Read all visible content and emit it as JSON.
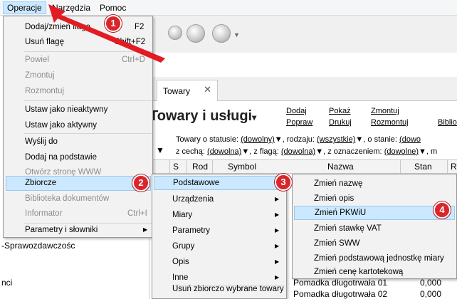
{
  "menubar": {
    "items": [
      "Operacje",
      "Narzędzia",
      "Pomoc"
    ]
  },
  "sidebar": {
    "fragments": [
      "-Sprawozdawczośc",
      "nci"
    ]
  },
  "tab": {
    "label": "Towary",
    "close": "✕"
  },
  "page": {
    "title": "Towary i usługi"
  },
  "links": [
    "Dodaj",
    "Popraw",
    "Pokaż",
    "Drukuj",
    "Zmontuj",
    "Rozmontuj",
    "Bibliot"
  ],
  "filters": {
    "row1_prefix": "Towary o statusie:",
    "status_value": "(dowolny)",
    "row1_mid": ", rodzaju:",
    "kind_value": "(wszystkie)",
    "row1_suffix": ", o stanie:",
    "state_value": "(dowo",
    "row2_prefix": "z cechą:",
    "feature_value": "(dowolna)",
    "row2_mid": ", z flagą:",
    "flag_value": "(dowolna)",
    "row2_mid2": ", z oznaczeniem:",
    "mark_value": "(dowolne)",
    "row2_suffix": ", m"
  },
  "grid": {
    "columns": [
      "S",
      "Rod",
      "Symbol",
      "Nazwa",
      "Stan",
      "R"
    ],
    "rows": [
      {
        "name": "Pomadka długotrwała 01",
        "stock": "0,000"
      },
      {
        "name": "Pomadka długotrwała 02",
        "stock": "0,000"
      }
    ]
  },
  "menu_operacje": [
    {
      "label": "Dodaj/zmień flagę",
      "shortcut": "F2",
      "disabled": false
    },
    {
      "label": "Usuń flagę",
      "shortcut": "Shift+F2",
      "disabled": false
    },
    {
      "label": "Powiel",
      "shortcut": "Ctrl+D",
      "disabled": true
    },
    {
      "label": "Zmontuj",
      "shortcut": "",
      "disabled": true
    },
    {
      "label": "Rozmontuj",
      "shortcut": "",
      "disabled": true
    },
    {
      "label": "Ustaw jako nieaktywny",
      "shortcut": "",
      "disabled": false
    },
    {
      "label": "Ustaw jako aktywny",
      "shortcut": "",
      "disabled": false
    },
    {
      "label": "Wyślij do",
      "shortcut": "",
      "disabled": false
    },
    {
      "label": "Dodaj na podstawie",
      "shortcut": "",
      "disabled": false
    },
    {
      "label": "Otwórz stronę WWW",
      "shortcut": "",
      "disabled": true
    },
    {
      "label": "Zbiorcze",
      "shortcut": "",
      "disabled": false
    },
    {
      "label": "Biblioteka dokumentów",
      "shortcut": "",
      "disabled": true
    },
    {
      "label": "Informator",
      "shortcut": "Ctrl+I",
      "disabled": true
    },
    {
      "label": "Parametry i słowniki",
      "shortcut": "",
      "disabled": false
    }
  ],
  "menu_zbiorcze": [
    "Podstawowe",
    "Urządzenia",
    "Miary",
    "Parametry",
    "Grupy",
    "Opis",
    "Inne",
    "Usuń zbiorczo wybrane towary"
  ],
  "menu_podstawowe": [
    "Zmień nazwę",
    "Zmień opis",
    "Zmień PKWiU",
    "Zmień stawkę VAT",
    "Zmień SWW",
    "Zmień podstawową jednostkę miary",
    "Zmień cenę kartotekową"
  ],
  "markers": [
    "1",
    "2",
    "3",
    "4"
  ],
  "colors": {
    "highlight": "#cce8ff",
    "marker": "#d9262b",
    "arrow": "#e31b23"
  }
}
